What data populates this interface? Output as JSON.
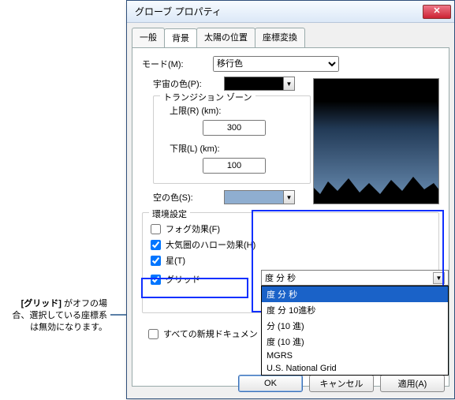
{
  "callout": {
    "strong": "[グリッド]",
    "rest": " がオフの場合、選択している座標系は無効になります。"
  },
  "dialog": {
    "title": "グローブ プロパティ",
    "close_glyph": "✕"
  },
  "tabs": [
    "一般",
    "背景",
    "太陽の位置",
    "座標変換"
  ],
  "active_tab_index": 1,
  "mode": {
    "label": "モード(M):",
    "value": "移行色"
  },
  "space_color": {
    "label": "宇宙の色(P):",
    "hex": "#000000"
  },
  "transition": {
    "legend": "トランジション ゾーン",
    "upper_label": "上限(R) (km):",
    "upper_value": "300",
    "lower_label": "下限(L) (km):",
    "lower_value": "100"
  },
  "sky_color": {
    "label": "空の色(S):",
    "hex": "#8faed0"
  },
  "env": {
    "legend": "環境設定",
    "fog": {
      "label": "フォグ効果(F)",
      "checked": false
    },
    "halo": {
      "label": "大気圏のハロー効果(H)",
      "checked": true
    },
    "stars": {
      "label": "星(T)",
      "checked": true
    },
    "grid": {
      "label": "グリッド",
      "checked": true
    },
    "grid_selected": "度 分 秒",
    "grid_options": [
      "度 分 秒",
      "度 分 10進秒",
      "分 (10 進)",
      "度 (10 進)",
      "MGRS",
      "U.S. National Grid"
    ]
  },
  "all_docs": {
    "label": "すべての新規ドキュメン",
    "checked": false
  },
  "buttons": {
    "ok": "OK",
    "cancel": "キャンセル",
    "apply": "適用(A)"
  },
  "glyphs": {
    "down": "▼"
  }
}
